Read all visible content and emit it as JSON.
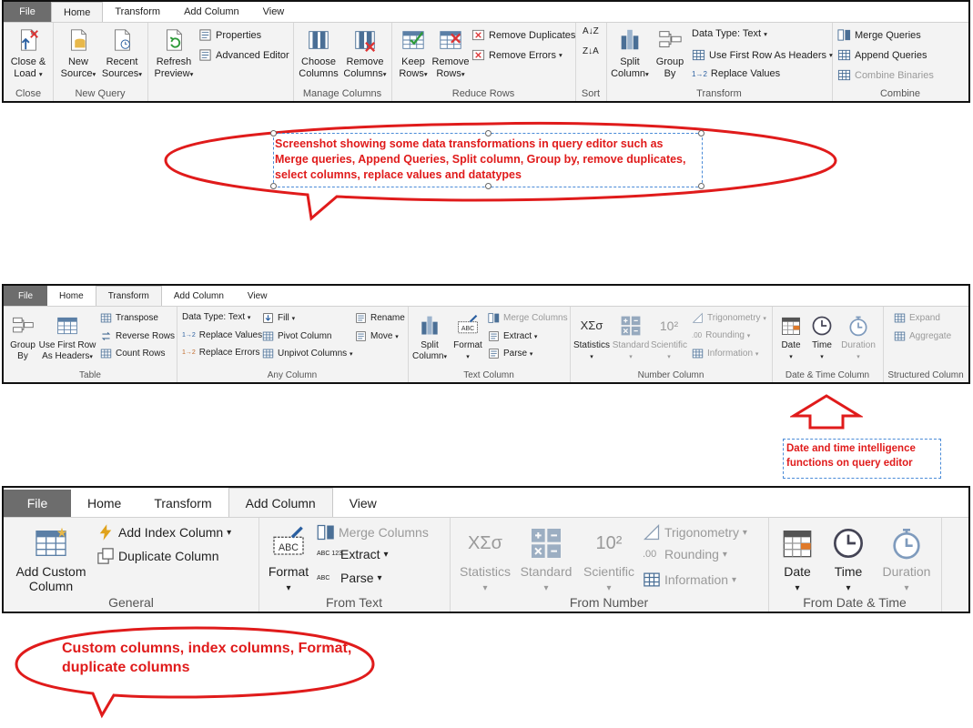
{
  "ribbon1": {
    "tabs": [
      "File",
      "Home",
      "Transform",
      "Add Column",
      "View"
    ],
    "active": "Home",
    "groups": {
      "close": {
        "label": "Close",
        "close_load": "Close &",
        "close_load2": "Load"
      },
      "new_query": {
        "label": "New Query",
        "new_source": "New",
        "new_source2": "Source",
        "recent": "Recent",
        "recent2": "Sources"
      },
      "query": {
        "refresh": "Refresh",
        "refresh2": "Preview",
        "properties": "Properties",
        "advanced": "Advanced Editor"
      },
      "manage": {
        "label": "Manage Columns",
        "choose": "Choose",
        "choose2": "Columns",
        "remove": "Remove",
        "remove2": "Columns"
      },
      "reduce": {
        "label": "Reduce Rows",
        "keep": "Keep",
        "keep2": "Rows",
        "remove": "Remove",
        "remove2": "Rows",
        "remove_dup": "Remove Duplicates",
        "remove_err": "Remove Errors"
      },
      "sort": {
        "label": "Sort"
      },
      "transform": {
        "label": "Transform",
        "split": "Split",
        "split2": "Column",
        "group": "Group",
        "group2": "By",
        "datatype": "Data Type: Text",
        "first_row": "Use First Row As Headers",
        "replace": "Replace Values"
      },
      "combine": {
        "label": "Combine",
        "merge": "Merge Queries",
        "append": "Append Queries",
        "binaries": "Combine Binaries"
      }
    }
  },
  "callout1": {
    "text": "Screenshot showing some data transformations in query editor such as Merge queries, Append Queries, Split column, Group by, remove duplicates, select columns, replace values and datatypes"
  },
  "ribbon2": {
    "tabs": [
      "File",
      "Home",
      "Transform",
      "Add Column",
      "View"
    ],
    "active": "Transform",
    "groups": {
      "table": {
        "label": "Table",
        "group": "Group",
        "group2": "By",
        "first_row": "Use First Row",
        "first_row2": "As Headers",
        "transpose": "Transpose",
        "reverse": "Reverse Rows",
        "count": "Count Rows"
      },
      "any": {
        "label": "Any Column",
        "datatype": "Data Type: Text",
        "replace_values": "Replace Values",
        "replace_errors": "Replace Errors",
        "fill": "Fill",
        "pivot": "Pivot Column",
        "unpivot": "Unpivot Columns",
        "rename": "Rename",
        "move": "Move"
      },
      "text": {
        "label": "Text Column",
        "split": "Split",
        "split2": "Column",
        "format": "Format",
        "merge": "Merge Columns",
        "extract": "Extract",
        "parse": "Parse"
      },
      "number": {
        "label": "Number Column",
        "statistics": "Statistics",
        "standard": "Standard",
        "scientific": "Scientific",
        "trig": "Trigonometry",
        "rounding": "Rounding",
        "information": "Information"
      },
      "datetime": {
        "label": "Date & Time Column",
        "date": "Date",
        "time": "Time",
        "duration": "Duration"
      },
      "structured": {
        "label": "Structured Column",
        "expand": "Expand",
        "aggregate": "Aggregate"
      }
    }
  },
  "callout2": {
    "text": "Date and time intelligence functions on query editor"
  },
  "ribbon3": {
    "tabs": [
      "File",
      "Home",
      "Transform",
      "Add Column",
      "View"
    ],
    "active": "Add Column",
    "groups": {
      "general": {
        "label": "General",
        "custom": "Add Custom",
        "custom2": "Column",
        "index": "Add Index Column",
        "duplicate": "Duplicate Column"
      },
      "text": {
        "label": "From Text",
        "format": "Format",
        "merge": "Merge Columns",
        "extract": "Extract",
        "parse": "Parse"
      },
      "number": {
        "label": "From Number",
        "statistics": "Statistics",
        "standard": "Standard",
        "scientific": "Scientific",
        "trig": "Trigonometry",
        "rounding": "Rounding",
        "information": "Information"
      },
      "datetime": {
        "label": "From Date & Time",
        "date": "Date",
        "time": "Time",
        "duration": "Duration"
      }
    }
  },
  "callout3": {
    "text": "Custom columns, index columns, Format, duplicate columns"
  },
  "icon_glyphs": {
    "sort_az": "A↓Z",
    "sort_za": "Z↓A",
    "statistics_glyph": "XΣσ",
    "scientific_glyph": "10²",
    "rounding_glyph": ".00",
    "replace_glyph": "1→2",
    "abc_glyph": "ABC",
    "abc123_glyph": "ABC 123",
    "dd": "▾"
  },
  "colors": {
    "accent_red": "#e01b1b",
    "selection_blue": "#4a8bd8",
    "file_tab": "#6d6d6d",
    "ribbon_bg": "#f3f3f3"
  }
}
